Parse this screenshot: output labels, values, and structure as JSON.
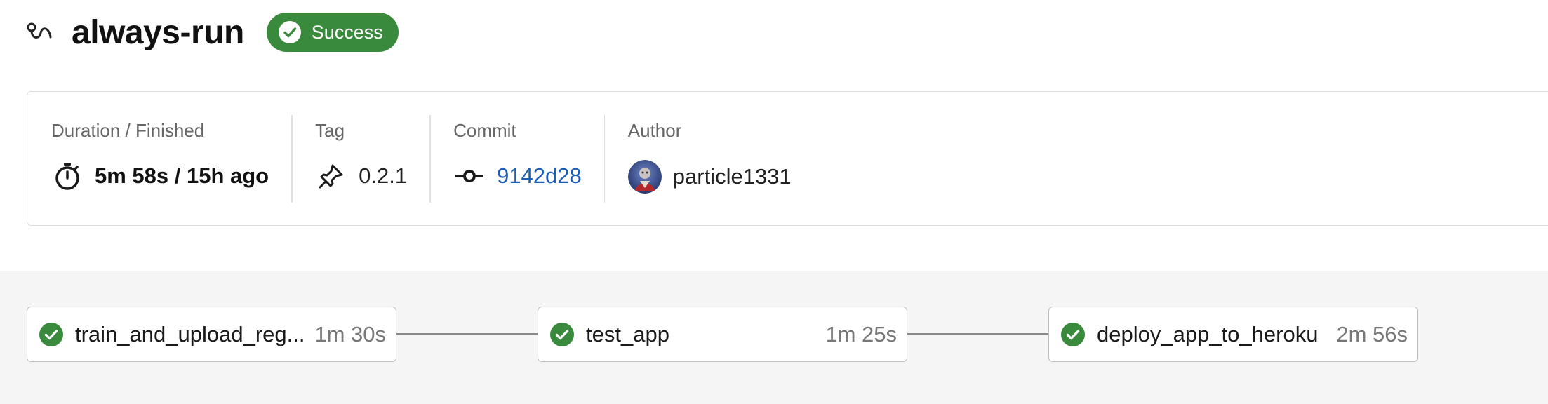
{
  "header": {
    "icon": "workflow-icon",
    "title": "always-run",
    "status": {
      "label": "Success",
      "icon": "check-circle-icon",
      "color": "#3a8a3d"
    }
  },
  "summary": {
    "duration": {
      "label": "Duration / Finished",
      "value": "5m 58s / 15h ago",
      "icon": "stopwatch-icon"
    },
    "tag": {
      "label": "Tag",
      "value": "0.2.1",
      "icon": "tag-pin-icon"
    },
    "commit": {
      "label": "Commit",
      "value": "9142d28",
      "icon": "commit-icon",
      "color": "#1f5eb5"
    },
    "author": {
      "label": "Author",
      "value": "particle1331"
    }
  },
  "pipeline": {
    "jobs": [
      {
        "name": "train_and_upload_reg...",
        "duration": "1m 30s",
        "status": "success"
      },
      {
        "name": "test_app",
        "duration": "1m 25s",
        "status": "success"
      },
      {
        "name": "deploy_app_to_heroku",
        "duration": "2m 56s",
        "status": "success"
      }
    ]
  },
  "colors": {
    "success": "#3a8a3d",
    "link": "#1f5eb5",
    "pipeline_background": "#f5f5f5"
  }
}
